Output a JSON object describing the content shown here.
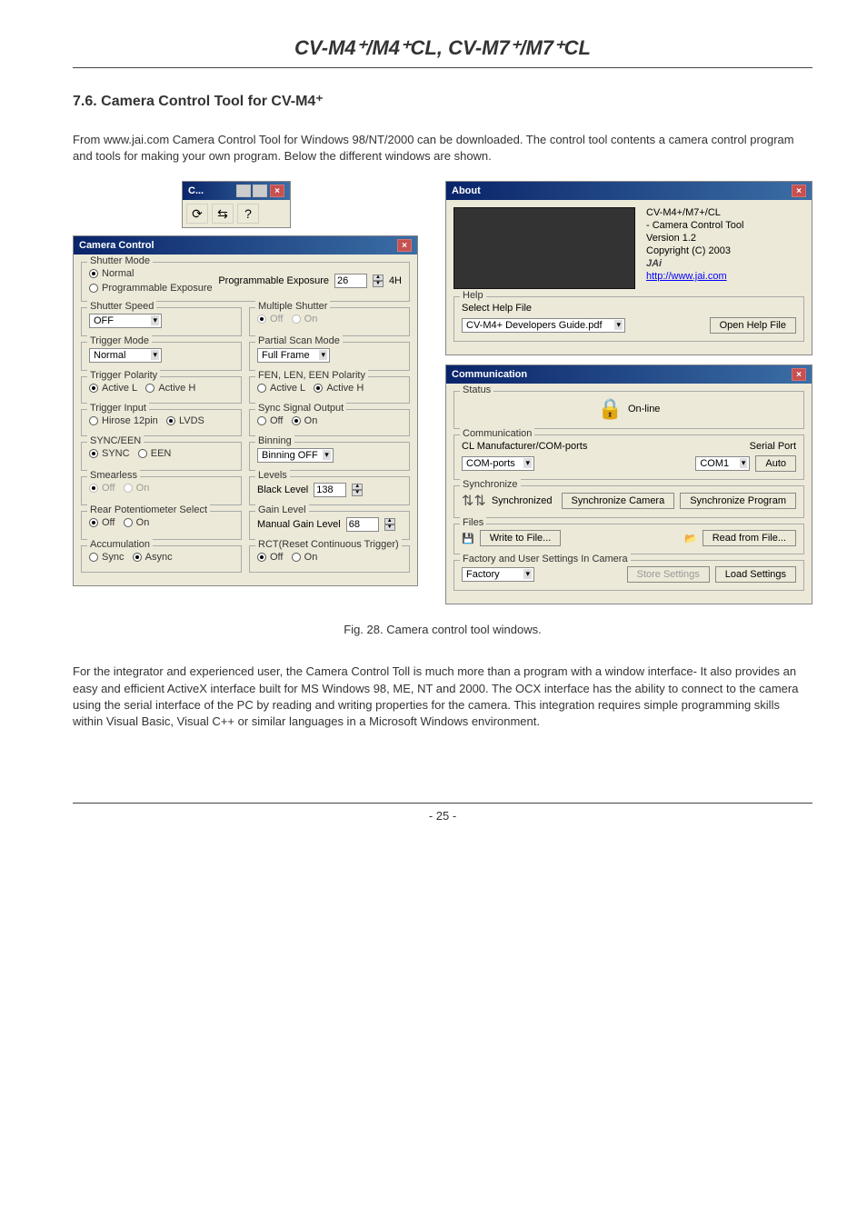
{
  "doc": {
    "title_html": "CV-M4⁺/M4⁺CL, CV-M7⁺/M7⁺CL",
    "section_title": "7.6. Camera Control Tool for CV-M4⁺",
    "intro": "From www.jai.com Camera Control Tool for Windows 98/NT/2000 can be downloaded. The control tool contents a camera control program and tools for making your own program. Below the different windows are shown.",
    "caption": "Fig. 28. Camera control tool windows.",
    "para2": "For the integrator and experienced user, the Camera Control Toll is much more than a program with a window interface- It also provides an easy and efficient ActiveX interface built for MS Windows 98, ME, NT and 2000. The OCX interface has the ability to connect to the camera using the serial interface of the PC by reading and writing properties for the camera. This integration requires simple programming skills within Visual Basic, Visual C++ or similar languages in a Microsoft Windows environment.",
    "page": "- 25 -"
  },
  "tool_small": {
    "title": "C..."
  },
  "camera_control": {
    "title": "Camera Control",
    "shutter_mode": {
      "legend": "Shutter Mode",
      "normal": "Normal",
      "prog": "Programmable Exposure",
      "pe_label": "Programmable Exposure",
      "pe_val": "26",
      "pe_unit": "4H"
    },
    "shutter_speed": {
      "legend": "Shutter Speed",
      "value": "OFF"
    },
    "multi_shutter": {
      "legend": "Multiple Shutter",
      "off": "Off",
      "on": "On"
    },
    "trigger_mode": {
      "legend": "Trigger Mode",
      "value": "Normal"
    },
    "partial_scan": {
      "legend": "Partial Scan Mode",
      "value": "Full Frame"
    },
    "trigger_polarity": {
      "legend": "Trigger Polarity",
      "al": "Active L",
      "ah": "Active H"
    },
    "fen_polarity": {
      "legend": "FEN, LEN, EEN Polarity",
      "al": "Active L",
      "ah": "Active H"
    },
    "trigger_input": {
      "legend": "Trigger Input",
      "hirose": "Hirose 12pin",
      "lvds": "LVDS"
    },
    "sync_out": {
      "legend": "Sync Signal Output",
      "off": "Off",
      "on": "On"
    },
    "sync_een": {
      "legend": "SYNC/EEN",
      "sync": "SYNC",
      "een": "EEN"
    },
    "binning": {
      "legend": "Binning",
      "value": "Binning OFF"
    },
    "smearless": {
      "legend": "Smearless",
      "off": "Off",
      "on": "On"
    },
    "levels": {
      "legend": "Levels",
      "black": "Black Level",
      "black_val": "138"
    },
    "rear_pot": {
      "legend": "Rear Potentiometer Select",
      "off": "Off",
      "on": "On"
    },
    "gain": {
      "legend": "Gain Level",
      "manual": "Manual Gain Level",
      "val": "68"
    },
    "accum": {
      "legend": "Accumulation",
      "sync": "Sync",
      "async": "Async"
    },
    "rct": {
      "legend": "RCT(Reset Continuous Trigger)",
      "off": "Off",
      "on": "On"
    }
  },
  "about": {
    "title": "About",
    "line1": "CV-M4+/M7+/CL",
    "line2": "- Camera Control Tool",
    "line3": "Version 1.2",
    "line4": "Copyright (C) 2003",
    "link": "http://www.jai.com",
    "help_legend": "Help",
    "help_select": "Select Help File",
    "help_val": "CV-M4+ Developers Guide.pdf",
    "open": "Open Help File"
  },
  "comm": {
    "title": "Communication",
    "status_legend": "Status",
    "status_text": "On-line",
    "comm_legend": "Communication",
    "cl_label": "CL Manufacturer/COM-ports",
    "serial_label": "Serial Port",
    "com_ports": "COM-ports",
    "com1": "COM1",
    "auto": "Auto",
    "sync_legend": "Synchronize",
    "synced": "Synchronized",
    "sync_cam": "Synchronize Camera",
    "sync_prog": "Synchronize Program",
    "files_legend": "Files",
    "write": "Write to File...",
    "read": "Read from File...",
    "factory_legend": "Factory and User Settings In Camera",
    "factory": "Factory",
    "store": "Store Settings",
    "load": "Load Settings"
  }
}
